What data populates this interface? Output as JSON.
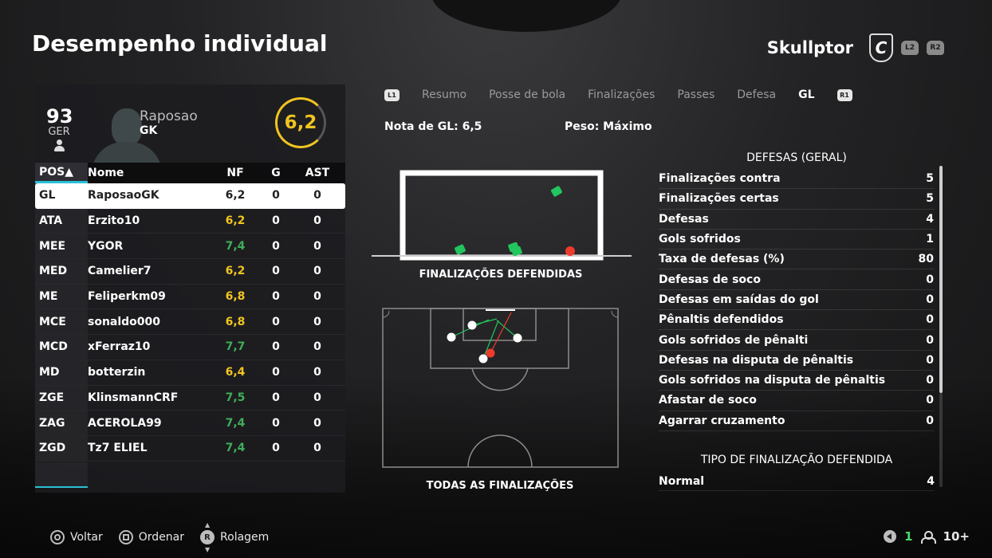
{
  "page": {
    "title": "Desempenho individual"
  },
  "user": {
    "name": "Skullptor",
    "club_letter": "C",
    "btn_l2": "L2",
    "btn_r2": "R2"
  },
  "player": {
    "overall": "93",
    "overall_label": "GER",
    "name": "Raposao",
    "position": "GK",
    "rating": "6,2"
  },
  "table": {
    "headers": {
      "pos": "POS▲",
      "name": "Nome",
      "nf": "NF",
      "g": "G",
      "ast": "AST"
    },
    "rows": [
      {
        "pos": "GL",
        "name": "RaposaoGK",
        "nf": "6,2",
        "nf_color": "#222222",
        "g": "0",
        "ast": "0"
      },
      {
        "pos": "ATA",
        "name": "Erzito10",
        "nf": "6,2",
        "nf_color": "#f0c420",
        "g": "0",
        "ast": "0"
      },
      {
        "pos": "MEE",
        "name": "YGOR",
        "nf": "7,4",
        "nf_color": "#3fae5a",
        "g": "0",
        "ast": "0"
      },
      {
        "pos": "MED",
        "name": "Camelier7",
        "nf": "6,2",
        "nf_color": "#f0c420",
        "g": "0",
        "ast": "0"
      },
      {
        "pos": "ME",
        "name": "Feliperkm09",
        "nf": "6,8",
        "nf_color": "#f0c420",
        "g": "0",
        "ast": "0"
      },
      {
        "pos": "MCE",
        "name": "sonaldo000",
        "nf": "6,8",
        "nf_color": "#f0c420",
        "g": "0",
        "ast": "0"
      },
      {
        "pos": "MCD",
        "name": "xFerraz10",
        "nf": "7,7",
        "nf_color": "#3fae5a",
        "g": "0",
        "ast": "0"
      },
      {
        "pos": "MD",
        "name": "botterzin",
        "nf": "6,4",
        "nf_color": "#f0c420",
        "g": "0",
        "ast": "0"
      },
      {
        "pos": "ZGE",
        "name": "KlinsmannCRF",
        "nf": "7,5",
        "nf_color": "#3fae5a",
        "g": "0",
        "ast": "0"
      },
      {
        "pos": "ZAG",
        "name": "ACEROLA99",
        "nf": "7,4",
        "nf_color": "#3fae5a",
        "g": "0",
        "ast": "0"
      },
      {
        "pos": "ZGD",
        "name": "Tz7 ELIEL",
        "nf": "7,4",
        "nf_color": "#3fae5a",
        "g": "0",
        "ast": "0"
      }
    ]
  },
  "tabs": {
    "left_chip": "L1",
    "right_chip": "R1",
    "items": [
      {
        "label": "Resumo"
      },
      {
        "label": "Posse de bola"
      },
      {
        "label": "Finalizações"
      },
      {
        "label": "Passes"
      },
      {
        "label": "Defesa"
      },
      {
        "label": "GL"
      }
    ]
  },
  "gk": {
    "rating_text": "Nota de GL: 6,5",
    "weight_text": "Peso: Máximo"
  },
  "charts": {
    "saved_label": "FINALIZAÇÕES DEFENDIDAS",
    "all_label": "TODAS AS FINALIZAÇÕES"
  },
  "stats": {
    "title": "DEFESAS (GERAL)",
    "rows": [
      {
        "label": "Finalizações contra",
        "value": "5"
      },
      {
        "label": "Finalizações certas",
        "value": "5"
      },
      {
        "label": "Defesas",
        "value": "4"
      },
      {
        "label": "Gols sofridos",
        "value": "1"
      },
      {
        "label": "Taxa de defesas (%)",
        "value": "80"
      },
      {
        "label": "Defesas de soco",
        "value": "0"
      },
      {
        "label": "Defesas em saídas do gol",
        "value": "0"
      },
      {
        "label": "Pênaltis defendidos",
        "value": "0"
      },
      {
        "label": "Gols sofridos de pênalti",
        "value": "0"
      },
      {
        "label": "Defesas na disputa de pênaltis",
        "value": "0"
      },
      {
        "label": "Gols sofridos na disputa de pênaltis",
        "value": "0"
      },
      {
        "label": "Afastar de soco",
        "value": "0"
      },
      {
        "label": "Agarrar cruzamento",
        "value": "0"
      }
    ],
    "type_title": "TIPO DE FINALIZAÇÃO DEFENDIDA",
    "type_row": {
      "label": "Normal",
      "value": "4"
    }
  },
  "footer": {
    "back": "Voltar",
    "sort": "Ordenar",
    "scroll": "Rolagem",
    "r_label": "R"
  },
  "corner": {
    "online_count": "1",
    "players": "10+"
  },
  "colors": {
    "accent": "#2bc0d8",
    "rating": "#f0c420",
    "good": "#3fae5a",
    "saved": "#22c55e",
    "goal": "#ef3b2c"
  }
}
